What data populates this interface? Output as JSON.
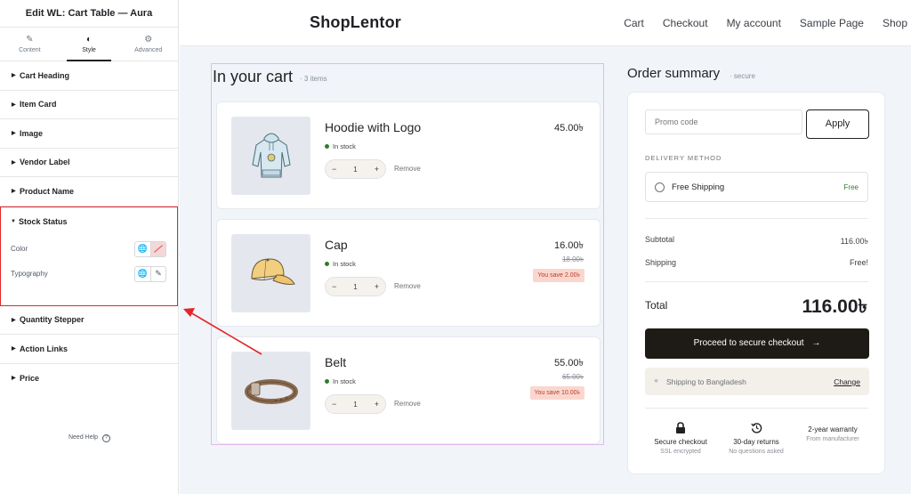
{
  "editor": {
    "title": "Edit WL: Cart Table — Aura",
    "tabs": [
      {
        "label": "Content",
        "icon": "pencil-icon"
      },
      {
        "label": "Style",
        "icon": "contrast-icon"
      },
      {
        "label": "Advanced",
        "icon": "gear-icon"
      }
    ],
    "sections_top": [
      "Cart Heading",
      "Item Card",
      "Image",
      "Vendor Label",
      "Product Name"
    ],
    "open_section": {
      "label": "Stock Status",
      "controls": [
        {
          "label": "Color",
          "icons": [
            "globe-icon",
            "no-color-icon"
          ]
        },
        {
          "label": "Typography",
          "icons": [
            "globe-icon",
            "edit-pencil-icon"
          ]
        }
      ]
    },
    "sections_bottom": [
      "Quantity Stepper",
      "Action Links",
      "Price"
    ],
    "need_help": "Need Help",
    "help_glyph": "?"
  },
  "site": {
    "brand": "ShopLentor",
    "nav": [
      "Cart",
      "Checkout",
      "My account",
      "Sample Page",
      "Shop"
    ]
  },
  "cart": {
    "title": "In your cart",
    "count": "· 3 items",
    "remove_label": "Remove",
    "stock_label": "In stock",
    "items": [
      {
        "name": "Hoodie with Logo",
        "price": "45.00৳",
        "qty": "1",
        "old_price": "",
        "save": "",
        "image": "hoodie"
      },
      {
        "name": "Cap",
        "price": "16.00৳",
        "qty": "1",
        "old_price": "18.00৳",
        "save": "You save 2.00৳",
        "image": "cap"
      },
      {
        "name": "Belt",
        "price": "55.00৳",
        "qty": "1",
        "old_price": "65.00৳",
        "save": "You save 10.00৳",
        "image": "belt"
      }
    ]
  },
  "summary": {
    "title": "Order summary",
    "secure": "· secure",
    "promo_placeholder": "Promo code",
    "apply": "Apply",
    "delivery_label": "DELIVERY METHOD",
    "shipping_option": "Free Shipping",
    "shipping_option_price": "Free",
    "subtotal_label": "Subtotal",
    "subtotal_value": "116.00৳",
    "shipping_label": "Shipping",
    "shipping_value": "Free!",
    "total_label": "Total",
    "total_value": "116.00৳",
    "checkout_label": "Proceed to secure checkout",
    "checkout_arrow": "→",
    "ship_to": "Shipping to Bangladesh",
    "change": "Change",
    "features": [
      {
        "title": "Secure checkout",
        "sub": "SSL encrypted",
        "icon": "lock-icon"
      },
      {
        "title": "30-day returns",
        "sub": "No questions asked",
        "icon": "history-icon"
      },
      {
        "title": "2-year warranty",
        "sub": "From manufacturer",
        "icon": ""
      }
    ]
  },
  "colors": {
    "annotation": "#e3262a",
    "checkout_bg": "#1e1b17",
    "in_stock": "#2e7d32",
    "save_badge_bg": "#f9d7ce",
    "highlight_border": "#e2b9ef"
  }
}
